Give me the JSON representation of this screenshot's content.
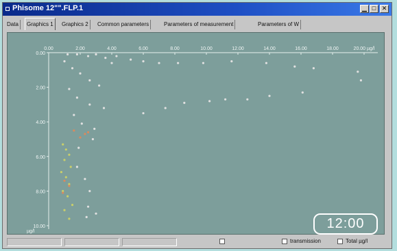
{
  "window": {
    "title": "Phisome 12\"\".FLP.1"
  },
  "tabs": [
    {
      "label": "Data",
      "active": false
    },
    {
      "label": "Graphics 1",
      "active": true
    },
    {
      "label": "Graphics 2",
      "active": false
    },
    {
      "label": "Common parameters",
      "active": false
    },
    {
      "label": "Parameters of measurement",
      "active": false
    },
    {
      "label": "Parameters of W",
      "active": false
    }
  ],
  "overlay": {
    "time": "12:00"
  },
  "status": {
    "checkboxes": [
      {
        "label": "",
        "checked": false
      },
      {
        "label": "transmission",
        "checked": false
      },
      {
        "label": "Total µg/l",
        "checked": false
      }
    ]
  },
  "chart_data": {
    "type": "scatter",
    "x_ticks": [
      "0.00",
      "2.00",
      "4.00",
      "6.00",
      "8.00",
      "10.00",
      "12.00",
      "14.00",
      "16.00",
      "18.00",
      "20.00 µg/l"
    ],
    "y_ticks": [
      "0.00",
      "2.00",
      "4.00",
      "6.00",
      "8.00",
      "10.00"
    ],
    "ylabel": "µg/l",
    "xlim": [
      0,
      20
    ],
    "ylim": [
      0,
      10
    ],
    "series": [
      {
        "color": "#e0e0e0",
        "points": [
          [
            1.2,
            0.1
          ],
          [
            1.8,
            0.1
          ],
          [
            2.5,
            0.2
          ],
          [
            3.0,
            0.1
          ],
          [
            3.6,
            0.3
          ],
          [
            4.3,
            0.2
          ],
          [
            4.0,
            0.6
          ],
          [
            5.2,
            0.4
          ],
          [
            6.0,
            0.5
          ],
          [
            7.0,
            0.6
          ],
          [
            8.2,
            0.6
          ],
          [
            9.8,
            0.6
          ],
          [
            11.6,
            0.5
          ],
          [
            13.8,
            0.6
          ],
          [
            15.6,
            0.8
          ],
          [
            16.8,
            0.9
          ],
          [
            19.6,
            1.1
          ],
          [
            1.0,
            0.5
          ],
          [
            1.5,
            0.9
          ],
          [
            2.0,
            1.2
          ],
          [
            2.6,
            1.6
          ],
          [
            3.2,
            1.9
          ],
          [
            1.3,
            2.1
          ],
          [
            1.8,
            2.6
          ],
          [
            2.6,
            3.0
          ],
          [
            3.5,
            3.2
          ],
          [
            7.4,
            3.2
          ],
          [
            8.6,
            2.9
          ],
          [
            10.2,
            2.8
          ],
          [
            11.2,
            2.7
          ],
          [
            12.6,
            2.7
          ],
          [
            14.0,
            2.5
          ],
          [
            16.1,
            2.3
          ],
          [
            19.8,
            1.6
          ],
          [
            6.0,
            3.5
          ],
          [
            1.6,
            3.6
          ],
          [
            2.1,
            4.1
          ],
          [
            2.9,
            4.4
          ],
          [
            1.9,
            5.5
          ],
          [
            2.8,
            5.0
          ],
          [
            1.8,
            6.6
          ],
          [
            2.3,
            7.3
          ],
          [
            2.6,
            8.0
          ],
          [
            2.5,
            8.9
          ],
          [
            3.0,
            9.3
          ],
          [
            2.4,
            9.5
          ]
        ]
      },
      {
        "color": "#c9cf6a",
        "points": [
          [
            0.9,
            5.3
          ],
          [
            1.1,
            5.6
          ],
          [
            1.3,
            5.9
          ],
          [
            1.0,
            6.2
          ],
          [
            1.4,
            6.6
          ],
          [
            0.8,
            6.9
          ],
          [
            1.1,
            7.2
          ],
          [
            1.3,
            7.6
          ],
          [
            0.9,
            8.0
          ],
          [
            1.2,
            8.3
          ],
          [
            1.5,
            8.8
          ],
          [
            1.0,
            9.1
          ],
          [
            1.3,
            9.6
          ]
        ]
      },
      {
        "color": "#d98a5e",
        "points": [
          [
            1.0,
            7.4
          ],
          [
            1.3,
            7.7
          ],
          [
            0.9,
            8.1
          ],
          [
            1.6,
            4.5
          ],
          [
            2.3,
            4.7
          ],
          [
            2.0,
            4.9
          ],
          [
            2.5,
            4.6
          ]
        ]
      }
    ]
  }
}
